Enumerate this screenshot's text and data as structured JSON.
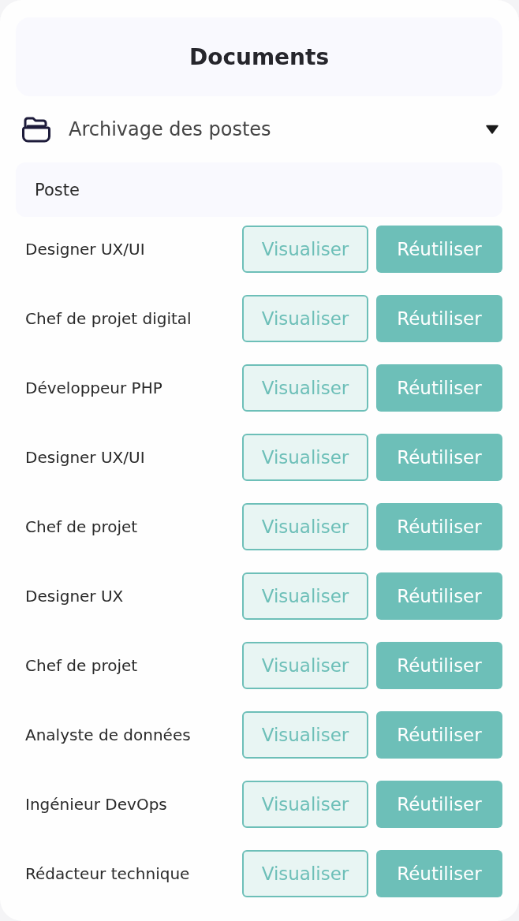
{
  "title": "Documents",
  "section": {
    "title": "Archivage des postes",
    "expanded": true
  },
  "table": {
    "columns": [
      "Poste"
    ],
    "rows": [
      {
        "title": "Designer UX/UI",
        "buttons": [
          {
            "kind": "outline",
            "label": "Visualiser"
          },
          {
            "kind": "filled",
            "label": "Réutiliser"
          }
        ]
      },
      {
        "title": "Chef de projet digital",
        "buttons": [
          {
            "kind": "outline",
            "label": "Visualiser"
          },
          {
            "kind": "filled",
            "label": "Réutiliser"
          }
        ]
      },
      {
        "title": "Développeur PHP",
        "buttons": [
          {
            "kind": "outline",
            "label": "Visualiser"
          },
          {
            "kind": "filled",
            "label": "Réutiliser"
          }
        ]
      },
      {
        "title": "Designer UX/UI",
        "buttons": [
          {
            "kind": "outline",
            "label": "Visualiser"
          },
          {
            "kind": "filled",
            "label": "Réutiliser"
          }
        ]
      },
      {
        "title": "Chef de projet",
        "buttons": [
          {
            "kind": "outline",
            "label": "Visualiser"
          },
          {
            "kind": "filled",
            "label": "Réutiliser"
          }
        ]
      },
      {
        "title": "Designer UX",
        "buttons": [
          {
            "kind": "outline",
            "label": "Visualiser"
          },
          {
            "kind": "filled",
            "label": "Réutiliser"
          }
        ]
      },
      {
        "title": "Chef de projet",
        "buttons": [
          {
            "kind": "outline",
            "label": "Visualiser"
          },
          {
            "kind": "filled",
            "label": "Réutiliser"
          }
        ]
      },
      {
        "title": "Analyste de données",
        "buttons": [
          {
            "kind": "outline",
            "label": "Visualiser"
          },
          {
            "kind": "filled",
            "label": "Réutiliser"
          }
        ]
      },
      {
        "title": "Ingénieur DevOps",
        "buttons": [
          {
            "kind": "outline",
            "label": "Visualiser"
          },
          {
            "kind": "filled",
            "label": "Réutiliser"
          }
        ]
      },
      {
        "title": "Rédacteur technique",
        "buttons": [
          {
            "kind": "outline",
            "label": "Visualiser"
          },
          {
            "kind": "filled",
            "label": "Réutiliser"
          }
        ]
      }
    ]
  }
}
